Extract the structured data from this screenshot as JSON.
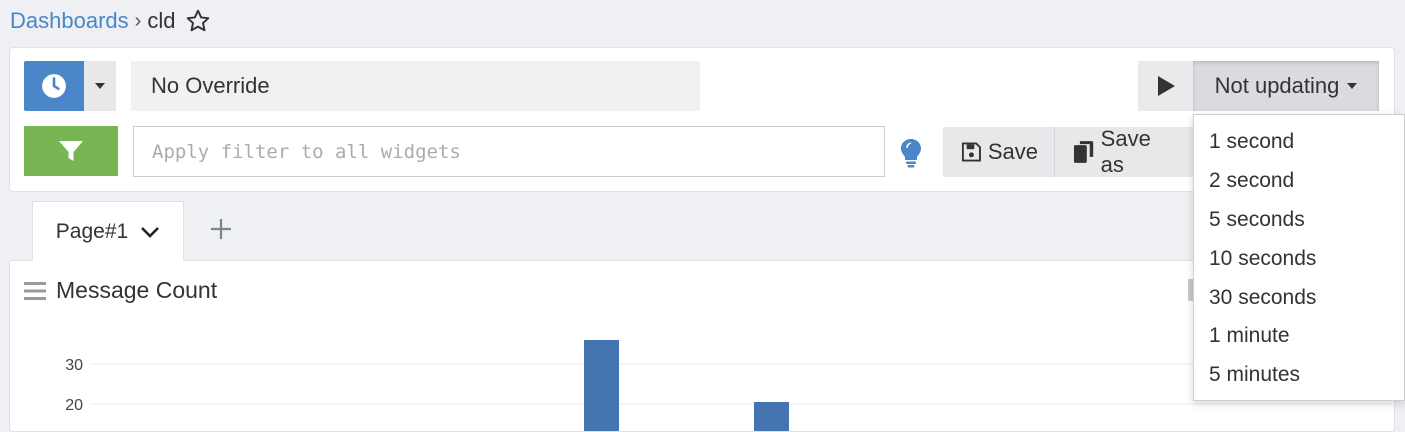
{
  "breadcrumb": {
    "root": "Dashboards",
    "separator": "›",
    "current": "cld"
  },
  "toolbar": {
    "override_value": "No Override",
    "refresh_label": "Not updating",
    "filter_placeholder": "Apply filter to all widgets",
    "filter_value": "",
    "save_label": "Save",
    "save_as_label": "Save as"
  },
  "tabs": [
    {
      "label": "Page#1"
    }
  ],
  "refresh_menu": {
    "options": [
      "1 second",
      "2 second",
      "5 seconds",
      "10 seconds",
      "30 seconds",
      "1 minute",
      "5 minutes"
    ]
  },
  "widget": {
    "title": "Message Count"
  },
  "chart_data": {
    "type": "bar",
    "y_ticks": [
      "30",
      "20"
    ],
    "bars": [
      37,
      20
    ],
    "bar_color": "#4575b0"
  },
  "colors": {
    "accent_blue": "#4a86c8",
    "filter_green": "#7ab553",
    "bar_blue": "#4575b0"
  },
  "icons": {
    "time": "clock-icon",
    "filter": "funnel-icon",
    "hint": "lightbulb-icon",
    "play": "play-icon",
    "save": "floppy-icon",
    "save_as": "copy-icon",
    "favorite": "star-icon"
  }
}
